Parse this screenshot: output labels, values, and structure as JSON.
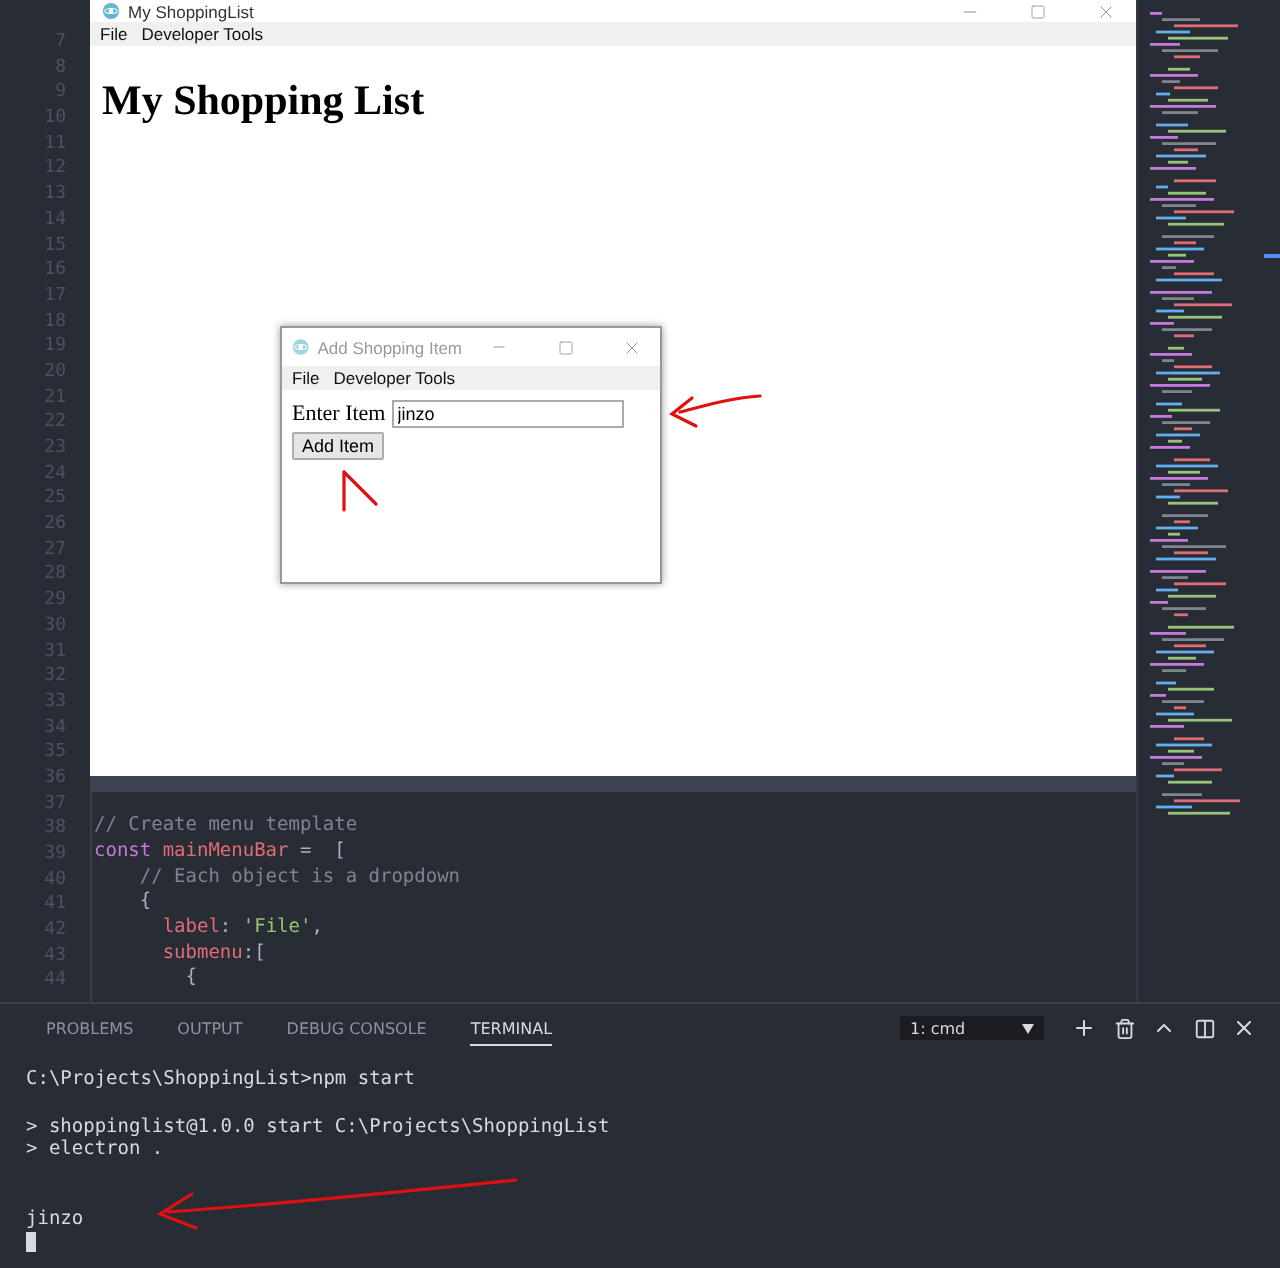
{
  "editor": {
    "line_numbers": [
      "7",
      "8",
      "9",
      "10",
      "11",
      "12",
      "13",
      "14",
      "15",
      "16",
      "17",
      "18",
      "19",
      "20",
      "21",
      "22",
      "23",
      "24",
      "25",
      "26",
      "27",
      "28",
      "29",
      "30",
      "31",
      "32",
      "33",
      "34",
      "35",
      "36",
      "37",
      "38",
      "39",
      "40",
      "41",
      "42",
      "43",
      "44"
    ],
    "code_lines": [
      [
        {
          "kind": "comment",
          "text": "// Create menu template"
        }
      ],
      [
        {
          "kind": "keyword",
          "text": "const"
        },
        {
          "kind": "variable",
          "text": " mainMenuBar"
        },
        {
          "kind": "plain",
          "text": " =  ["
        }
      ],
      [
        {
          "kind": "comment",
          "text": "    // Each object is a dropdown"
        }
      ],
      [
        {
          "kind": "plain",
          "text": "    {"
        }
      ],
      [
        {
          "kind": "variable",
          "text": "      label"
        },
        {
          "kind": "plain",
          "text": ": "
        },
        {
          "kind": "string",
          "text": "'File'"
        },
        {
          "kind": "plain",
          "text": ","
        }
      ],
      [
        {
          "kind": "variable",
          "text": "      submenu"
        },
        {
          "kind": "plain",
          "text": ":["
        }
      ],
      [
        {
          "kind": "plain",
          "text": "        {"
        }
      ]
    ]
  },
  "main_window": {
    "title": "My ShoppingList",
    "menu": [
      "File",
      "Developer Tools"
    ],
    "heading": "My Shopping List"
  },
  "dialog": {
    "title": "Add Shopping Item",
    "active": false,
    "menu": [
      "File",
      "Developer Tools"
    ],
    "label": "Enter Item",
    "value": "jinzo",
    "button": "Add Item"
  },
  "panel": {
    "tabs": [
      {
        "label": "PROBLEMS",
        "selected": false
      },
      {
        "label": "OUTPUT",
        "selected": false
      },
      {
        "label": "DEBUG CONSOLE",
        "selected": false
      },
      {
        "label": "TERMINAL",
        "selected": true
      }
    ],
    "terminal_select": "1: cmd",
    "terminal_lines": [
      {
        "kind": "line",
        "text": "C:\\Projects\\ShoppingList>npm start"
      },
      {
        "kind": "paragraph",
        "text": "> shoppinglist@1.0.0 start C:\\Projects\\ShoppingList"
      },
      {
        "kind": "line",
        "text": "> electron ."
      },
      {
        "kind": "section",
        "text": "jinzo"
      }
    ]
  }
}
